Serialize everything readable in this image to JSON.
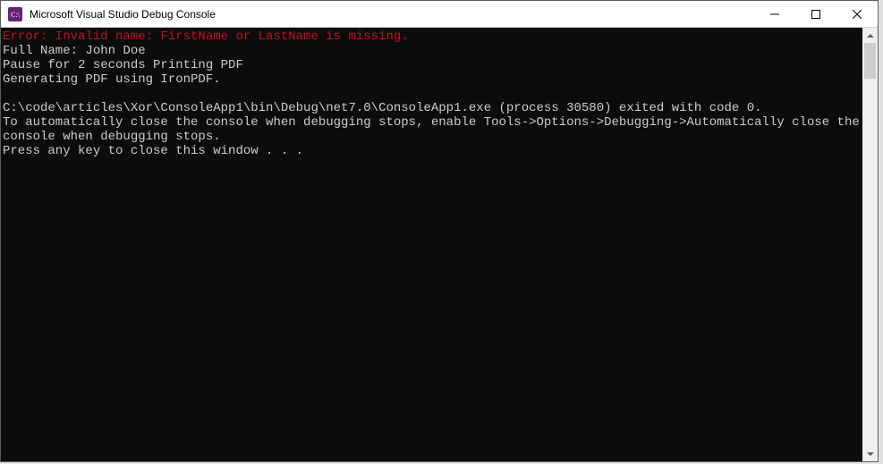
{
  "window": {
    "title": "Microsoft Visual Studio Debug Console"
  },
  "console": {
    "error_line": "Error: Invalid name: FirstName or LastName is missing.",
    "line2": "Full Name: John Doe",
    "line3": "Pause for 2 seconds Printing PDF",
    "line4": "Generating PDF using IronPDF.",
    "blank": "",
    "line5": "C:\\code\\articles\\Xor\\ConsoleApp1\\bin\\Debug\\net7.0\\ConsoleApp1.exe (process 30580) exited with code 0.",
    "line6": "To automatically close the console when debugging stops, enable Tools->Options->Debugging->Automatically close the console when debugging stops.",
    "line7": "Press any key to close this window . . ."
  }
}
